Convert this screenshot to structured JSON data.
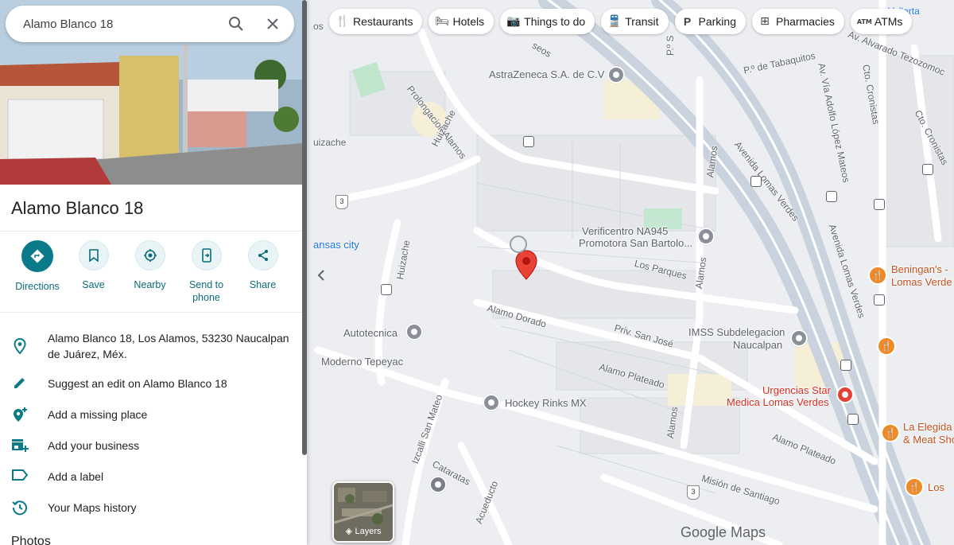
{
  "search": {
    "value": "Alamo Blanco 18"
  },
  "filters": [
    {
      "label": "Restaurants",
      "icon": "fork-knife-icon"
    },
    {
      "label": "Hotels",
      "icon": "bed-icon"
    },
    {
      "label": "Things to do",
      "icon": "camera-icon"
    },
    {
      "label": "Transit",
      "icon": "train-icon"
    },
    {
      "label": "Parking",
      "icon": "parking-icon"
    },
    {
      "label": "Pharmacies",
      "icon": "pharmacy-icon"
    },
    {
      "label": "ATMs",
      "icon": "atm-icon"
    }
  ],
  "place": {
    "title": "Alamo Blanco 18"
  },
  "actions": [
    {
      "label": "Directions"
    },
    {
      "label": "Save"
    },
    {
      "label": "Nearby"
    },
    {
      "label": "Send to phone"
    },
    {
      "label": "Share"
    }
  ],
  "details": {
    "address": "Alamo Blanco 18, Los Alamos, 53230 Naucalpan de Juárez, Méx.",
    "suggest_edit": "Suggest an edit on Alamo Blanco 18",
    "add_missing": "Add a missing place",
    "add_business": "Add your business",
    "add_label": "Add a label",
    "history": "Your Maps history"
  },
  "photos_heading": "Photos",
  "map": {
    "labels": {
      "astrazeneca": "AstraZeneca S.A. de C.V",
      "verificentro_1": "Verificentro NA945",
      "verificentro_2": "Promotora San Bartolo...",
      "autotecnica": "Autotecnica",
      "moderno": "Moderno Tepeyac",
      "hockey": "Hockey Rinks MX",
      "imss_1": "IMSS Subdelegacion",
      "imss_2": "Naucalpan",
      "urgencias_1": "Urgencias Star",
      "urgencias_2": "Medica Lomas Verdes",
      "benigans_1": "Beningan's -",
      "benigans_2": "Lomas Verde",
      "elegida_1": "La Elegida",
      "elegida_2": "& Meat Sho",
      "los": "Los",
      "kansas": "ansas city",
      "vallarta": "Vallarta",
      "st_prolongacion": "Prolongacion Alamos",
      "st_huizache1": "Huizache",
      "st_huizache2": "Huizache",
      "st_huizache3": "uizache",
      "st_tabaquitos": "P.º de Tabaquitos",
      "st_tezozomoc": "Av. Alvarado Tezozomoc",
      "st_avenida_lv": "Avenida Lomas Verdes",
      "st_avenida_lv2": "Avenida Lomas Verdes",
      "st_adolfo": "Av. Vía Adolfo López Mateos",
      "st_cronistas1": "Cto. Cronistas",
      "st_cronistas2": "Cto. Cronistas",
      "st_alamos1": "Alamos",
      "st_alamos2": "Alamos",
      "st_alamos3": "Alamos",
      "st_losparques": "Los Parques",
      "st_alamodorado": "Alamo Dorado",
      "st_sanjose": "Priv. San José",
      "st_plateado1": "Alamo Plateado",
      "st_plateado2": "Alamo Plateado",
      "st_izcalli": "Izcalli San Mateo",
      "st_cataratas": "Cataratas",
      "st_acueducto": "Acueducto",
      "st_mision": "Misión de Santiago",
      "st_ps": "P.º S",
      "st_seos": "seos",
      "st_os": "os",
      "shield_3a": "3",
      "shield_3b": "3"
    },
    "layers_label": "Layers",
    "logo": "Google Maps"
  },
  "colors": {
    "accent": "#0b7b8a",
    "marker": "#ea4335",
    "map_bg": "#eceef1",
    "road": "#ffffff",
    "highway": "#c7d0db"
  }
}
